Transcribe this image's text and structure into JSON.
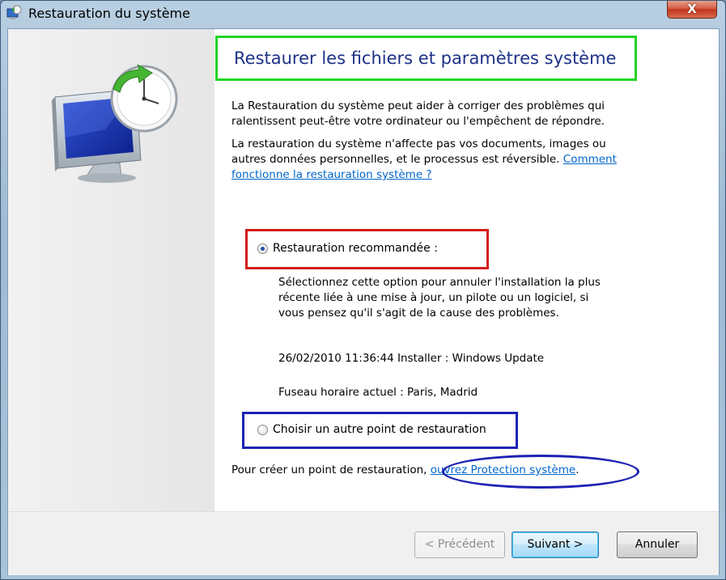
{
  "window": {
    "title": "Restauration du système",
    "close_label": "X"
  },
  "main": {
    "heading": "Restaurer les fichiers et paramètres système",
    "intro_line1": "La Restauration du système peut aider à corriger des problèmes qui",
    "intro_line2": "ralentissent peut-être votre ordinateur ou l'empêchent de répondre.",
    "info_line1": "La restauration du système n'affecte pas vos documents, images ou",
    "info_line2": "autres données personnelles, et le processus est réversible.",
    "info_link_part1": "Comment",
    "info_link_part2": "fonctionne la restauration système ?",
    "recommended_label": "Restauration recommandée :",
    "recommended_desc_line1": "Sélectionnez cette option pour annuler l'installation la plus",
    "recommended_desc_line2": "récente liée à une mise à jour, un pilote ou un logiciel, si",
    "recommended_desc_line3": "vous pensez qu'il s'agit de la cause des problèmes.",
    "restore_point": "26/02/2010 11:36:44 Installer : Windows Update",
    "timezone": "Fuseau horaire actuel : Paris, Madrid",
    "other_point_label": "Choisir un autre point de restauration",
    "create_prefix": "Pour créer un point de restauration,",
    "create_link": "ouvrez Protection système",
    "create_suffix": "."
  },
  "footer": {
    "previous_label": "< Précédent",
    "next_label": "Suivant >",
    "cancel_label": "Annuler"
  },
  "colors": {
    "heading": "#1e3287",
    "link": "#0066cc",
    "highlight_green": "#22d322",
    "highlight_red": "#d41d1d",
    "highlight_blue": "#1d22b3"
  }
}
